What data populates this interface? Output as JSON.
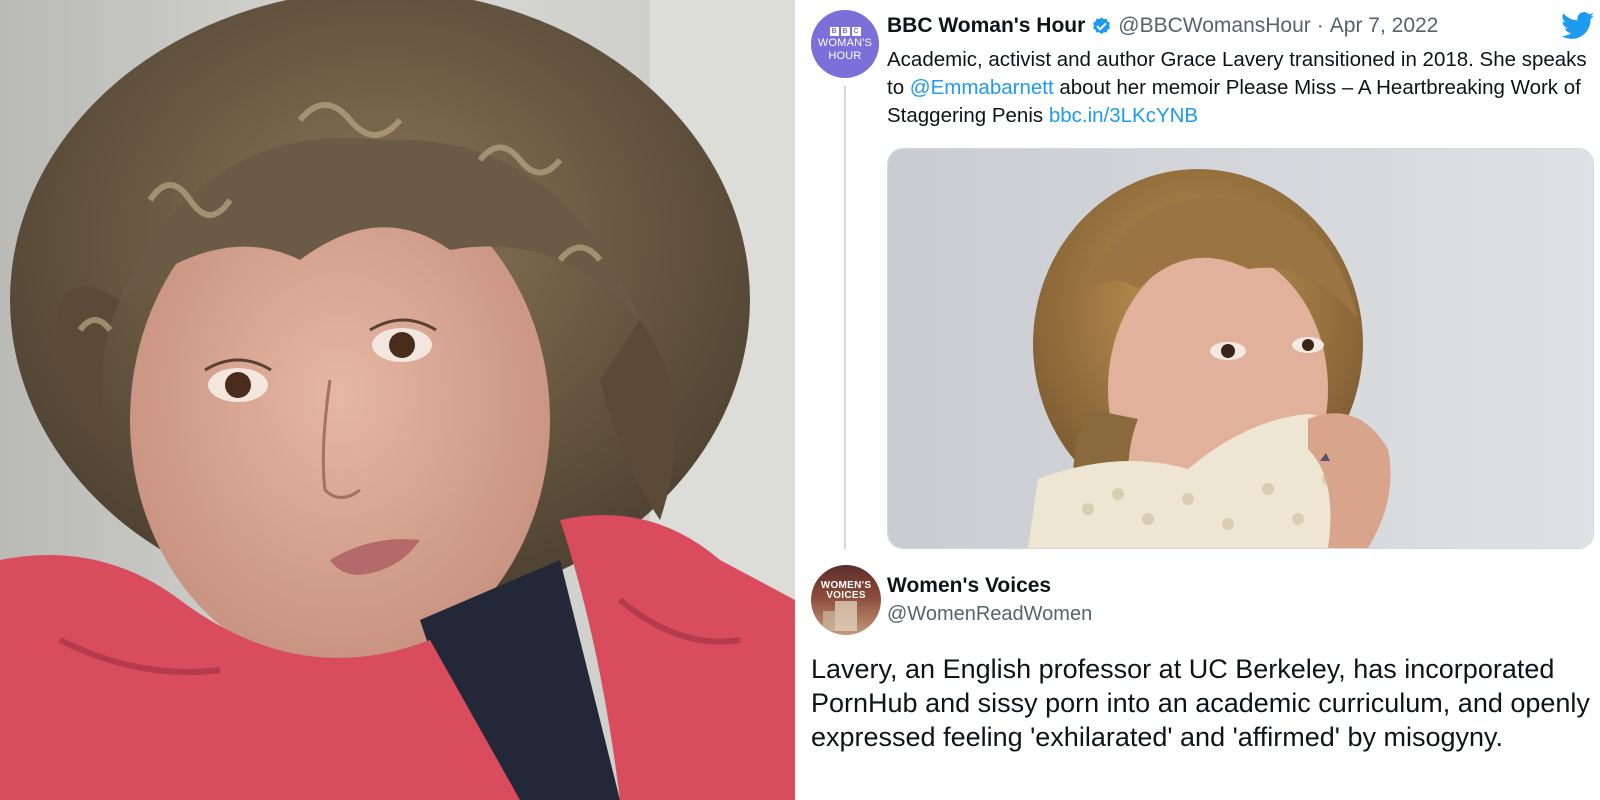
{
  "left_photo": {
    "description_icon": "selfie-photo",
    "colors": {
      "background": "#cfcfcc",
      "jacket": "#d84c5e",
      "hair": "#6b5a45"
    }
  },
  "tweet1": {
    "avatar": {
      "line1": "BBC",
      "bbc_letters": [
        "B",
        "B",
        "C"
      ],
      "line2": "WOMAN'S",
      "line3": "HOUR",
      "color": "#7b6fd9"
    },
    "name": "BBC Woman's Hour",
    "handle": "@BBCWomansHour",
    "separator": "·",
    "date": "Apr 7, 2022",
    "text_part1": "Academic, activist and author Grace Lavery transitioned in 2018.  She speaks to ",
    "mention": "@Emmabarnett",
    "text_part2": " about her memoir Please Miss – A Heartbreaking Work of Staggering Penis ",
    "link": "bbc.in/3LKcYNB",
    "media_icon": "portrait-photo"
  },
  "tweet2": {
    "avatar": {
      "line1": "WOMEN'S",
      "line2": "VOICES"
    },
    "name": "Women's Voices",
    "handle": "@WomenReadWomen",
    "text": "Lavery, an English professor at UC Berkeley, has incorporated PornHub and sissy porn into an academic curriculum, and openly expressed feeling 'exhilarated' and 'affirmed' by misogyny."
  },
  "colors": {
    "twitter_blue": "#1d9bf0",
    "secondary_text": "#536471",
    "border": "#cfd9de"
  }
}
